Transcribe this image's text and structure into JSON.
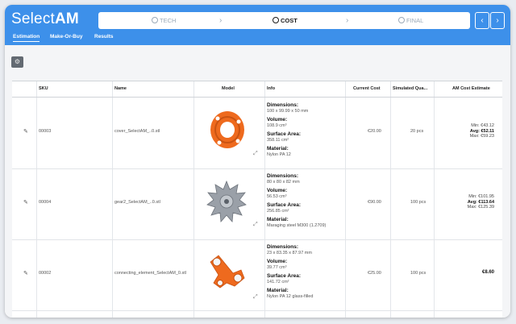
{
  "app": {
    "logo_a": "Select",
    "logo_b": "AM"
  },
  "steps": [
    {
      "label": "TECH",
      "state": "done"
    },
    {
      "label": "COST",
      "state": "active"
    },
    {
      "label": "FINAL",
      "state": "pending"
    }
  ],
  "step_arrow": "›",
  "pager": {
    "prev": "‹",
    "next": "›"
  },
  "tabs": [
    {
      "label": "Estimation",
      "active": true
    },
    {
      "label": "Make-Or-Buy",
      "active": false
    },
    {
      "label": "Results",
      "active": false
    }
  ],
  "toolbar": {
    "settings_icon": "⚙"
  },
  "table": {
    "headers": [
      "SKU",
      "Name",
      "Model",
      "Info",
      "Current Cost",
      "Simulated Qua...",
      "AM Cost Estimate"
    ],
    "rows": [
      {
        "sku": "00003",
        "name": "cover_SelectAM_..0.stl",
        "model_color": "#ee6a1e",
        "info": {
          "dim_label": "Dimensions:",
          "dim": "100 x 99.99 x 50 mm",
          "vol_label": "Volume:",
          "vol": "108.9 cm³",
          "surf_label": "Surface Area:",
          "surf": "358.11 cm²",
          "mat_label": "Material:",
          "mat": "Nylon PA 12"
        },
        "current_cost": "€20.00",
        "quantity": "20 pcs",
        "estimate": {
          "min": "Min: €43.12",
          "avg": "Avg: €52.11",
          "max": "Max: €59.23"
        }
      },
      {
        "sku": "00004",
        "name": "gear2_SelectAM_..0.stl",
        "model_color": "#9aa0a8",
        "info": {
          "dim_label": "Dimensions:",
          "dim": "80 x 80 x 82 mm",
          "vol_label": "Volume:",
          "vol": "56.53 cm³",
          "surf_label": "Surface Area:",
          "surf": "256.85 cm²",
          "mat_label": "Material:",
          "mat": "Maraging steel M300 (1.2709)"
        },
        "current_cost": "€90.00",
        "quantity": "100 pcs",
        "estimate": {
          "min": "Min: €101.95",
          "avg": "Avg: €113.64",
          "max": "Max: €125.39"
        }
      },
      {
        "sku": "00002",
        "name": "connecting_element_SelectAM_0.stl",
        "model_color": "#ee6a1e",
        "info": {
          "dim_label": "Dimensions:",
          "dim": "23 x 83.35 x 87.97 mm",
          "vol_label": "Volume:",
          "vol": "39.77 cm³",
          "surf_label": "Surface Area:",
          "surf": "141.72 cm²",
          "mat_label": "Material:",
          "mat": "Nylon PA 12 glass-filled"
        },
        "current_cost": "€25.00",
        "quantity": "100 pcs",
        "estimate": {
          "single": "€8.60"
        }
      }
    ]
  },
  "icons": {
    "edit": "✎",
    "expand": "⤢"
  }
}
